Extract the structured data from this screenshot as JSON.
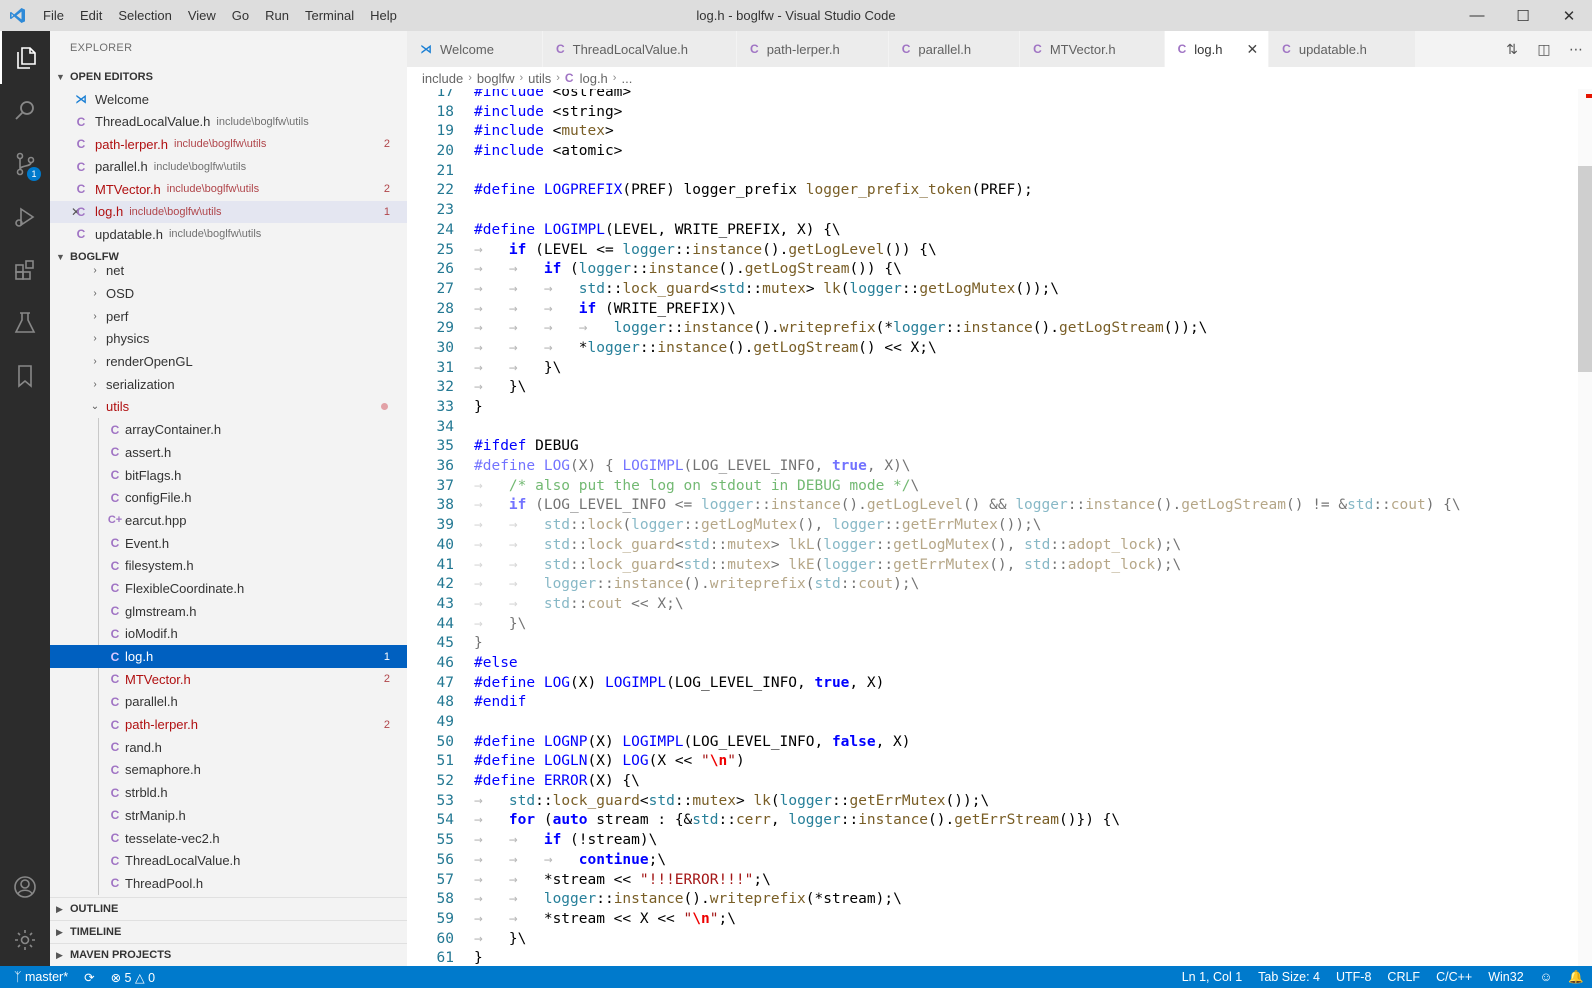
{
  "window": {
    "title": "log.h - boglfw - Visual Studio Code"
  },
  "menu": [
    "File",
    "Edit",
    "Selection",
    "View",
    "Go",
    "Run",
    "Terminal",
    "Help"
  ],
  "activity_bar": {
    "scm_badge": "1"
  },
  "explorer": {
    "title": "EXPLORER",
    "open_editors_title": "OPEN EDITORS",
    "open_editors": [
      {
        "name": "Welcome",
        "desc": "",
        "count": ""
      },
      {
        "name": "ThreadLocalValue.h",
        "desc": "include\\boglfw\\utils",
        "count": ""
      },
      {
        "name": "path-lerper.h",
        "desc": "include\\boglfw\\utils",
        "count": "2"
      },
      {
        "name": "parallel.h",
        "desc": "include\\boglfw\\utils",
        "count": ""
      },
      {
        "name": "MTVector.h",
        "desc": "include\\boglfw\\utils",
        "count": "2"
      },
      {
        "name": "log.h",
        "desc": "include\\boglfw\\utils",
        "count": "1"
      },
      {
        "name": "updatable.h",
        "desc": "include\\boglfw\\utils",
        "count": ""
      }
    ],
    "project_title": "BOGLFW",
    "folders": [
      "net",
      "OSD",
      "perf",
      "physics",
      "renderOpenGL",
      "serialization",
      "utils"
    ],
    "utils_files": [
      {
        "name": "arrayContainer.h",
        "count": ""
      },
      {
        "name": "assert.h",
        "count": ""
      },
      {
        "name": "bitFlags.h",
        "count": ""
      },
      {
        "name": "configFile.h",
        "count": ""
      },
      {
        "name": "earcut.hpp",
        "count": ""
      },
      {
        "name": "Event.h",
        "count": ""
      },
      {
        "name": "filesystem.h",
        "count": ""
      },
      {
        "name": "FlexibleCoordinate.h",
        "count": ""
      },
      {
        "name": "glmstream.h",
        "count": ""
      },
      {
        "name": "ioModif.h",
        "count": ""
      },
      {
        "name": "log.h",
        "count": "1"
      },
      {
        "name": "MTVector.h",
        "count": "2"
      },
      {
        "name": "parallel.h",
        "count": ""
      },
      {
        "name": "path-lerper.h",
        "count": "2"
      },
      {
        "name": "rand.h",
        "count": ""
      },
      {
        "name": "semaphore.h",
        "count": ""
      },
      {
        "name": "strbld.h",
        "count": ""
      },
      {
        "name": "strManip.h",
        "count": ""
      },
      {
        "name": "tesselate-vec2.h",
        "count": ""
      },
      {
        "name": "ThreadLocalValue.h",
        "count": ""
      },
      {
        "name": "ThreadPool.h",
        "count": ""
      }
    ],
    "bottom_sections": [
      "OUTLINE",
      "TIMELINE",
      "MAVEN PROJECTS"
    ]
  },
  "tabs": [
    "Welcome",
    "ThreadLocalValue.h",
    "path-lerper.h",
    "parallel.h",
    "MTVector.h",
    "log.h",
    "updatable.h"
  ],
  "breadcrumbs": [
    "include",
    "boglfw",
    "utils",
    "log.h",
    "..."
  ],
  "editor": {
    "lines": [
      {
        "n": "17",
        "t": "#include <ostream>"
      },
      {
        "n": "18",
        "t": "#include <string>"
      },
      {
        "n": "19",
        "t": "#include <mutex>"
      },
      {
        "n": "20",
        "t": "#include <atomic>"
      },
      {
        "n": "21",
        "t": ""
      },
      {
        "n": "22",
        "t": "#define LOGPREFIX(PREF) logger_prefix logger_prefix_token(PREF);"
      },
      {
        "n": "23",
        "t": ""
      },
      {
        "n": "24",
        "t": "#define LOGIMPL(LEVEL, WRITE_PREFIX, X) {\\"
      },
      {
        "n": "25",
        "t": "→   if (LEVEL <= logger::instance().getLogLevel()) {\\"
      },
      {
        "n": "26",
        "t": "→   →   if (logger::instance().getLogStream()) {\\"
      },
      {
        "n": "27",
        "t": "→   →   →   std::lock_guard<std::mutex> lk(logger::getLogMutex());\\"
      },
      {
        "n": "28",
        "t": "→   →   →   if (WRITE_PREFIX)\\"
      },
      {
        "n": "29",
        "t": "→   →   →   →   logger::instance().writeprefix(*logger::instance().getLogStream());\\"
      },
      {
        "n": "30",
        "t": "→   →   →   *logger::instance().getLogStream() << X;\\"
      },
      {
        "n": "31",
        "t": "→   →   }\\"
      },
      {
        "n": "32",
        "t": "→   }\\"
      },
      {
        "n": "33",
        "t": "}"
      },
      {
        "n": "34",
        "t": ""
      },
      {
        "n": "35",
        "t": "#ifdef DEBUG"
      },
      {
        "n": "36",
        "t": "#define LOG(X) { LOGIMPL(LOG_LEVEL_INFO, true, X)\\"
      },
      {
        "n": "37",
        "t": "→   /* also put the log on stdout in DEBUG mode */\\"
      },
      {
        "n": "38",
        "t": "→   if (LOG_LEVEL_INFO <= logger::instance().getLogLevel() && logger::instance().getLogStream() != &std::cout) {\\"
      },
      {
        "n": "39",
        "t": "→   →   std::lock(logger::getLogMutex(), logger::getErrMutex());\\"
      },
      {
        "n": "40",
        "t": "→   →   std::lock_guard<std::mutex> lkL(logger::getLogMutex(), std::adopt_lock);\\"
      },
      {
        "n": "41",
        "t": "→   →   std::lock_guard<std::mutex> lkE(logger::getErrMutex(), std::adopt_lock);\\"
      },
      {
        "n": "42",
        "t": "→   →   logger::instance().writeprefix(std::cout);\\"
      },
      {
        "n": "43",
        "t": "→   →   std::cout << X;\\"
      },
      {
        "n": "44",
        "t": "→   }\\"
      },
      {
        "n": "45",
        "t": "}"
      },
      {
        "n": "46",
        "t": "#else"
      },
      {
        "n": "47",
        "t": "#define LOG(X) LOGIMPL(LOG_LEVEL_INFO, true, X)"
      },
      {
        "n": "48",
        "t": "#endif"
      },
      {
        "n": "49",
        "t": ""
      },
      {
        "n": "50",
        "t": "#define LOGNP(X) LOGIMPL(LOG_LEVEL_INFO, false, X)"
      },
      {
        "n": "51",
        "t": "#define LOGLN(X) LOG(X << \"\\n\")"
      },
      {
        "n": "52",
        "t": "#define ERROR(X) {\\"
      },
      {
        "n": "53",
        "t": "→   std::lock_guard<std::mutex> lk(logger::getErrMutex());\\"
      },
      {
        "n": "54",
        "t": "→   for (auto stream : {&std::cerr, logger::instance().getErrStream()}) {\\"
      },
      {
        "n": "55",
        "t": "→   →   if (!stream)\\"
      },
      {
        "n": "56",
        "t": "→   →   →   continue;\\"
      },
      {
        "n": "57",
        "t": "→   →   *stream << \"!!!ERROR!!!\";\\"
      },
      {
        "n": "58",
        "t": "→   →   logger::instance().writeprefix(*stream);\\"
      },
      {
        "n": "59",
        "t": "→   →   *stream << X << \"\\n\";\\"
      },
      {
        "n": "60",
        "t": "→   }\\"
      },
      {
        "n": "61",
        "t": "}"
      }
    ]
  },
  "status": {
    "branch": "master*",
    "errors": "5",
    "warnings": "0",
    "position": "Ln 1, Col 1",
    "tab_size": "Tab Size: 4",
    "encoding": "UTF-8",
    "eol": "CRLF",
    "language": "C/C++",
    "platform": "Win32"
  }
}
